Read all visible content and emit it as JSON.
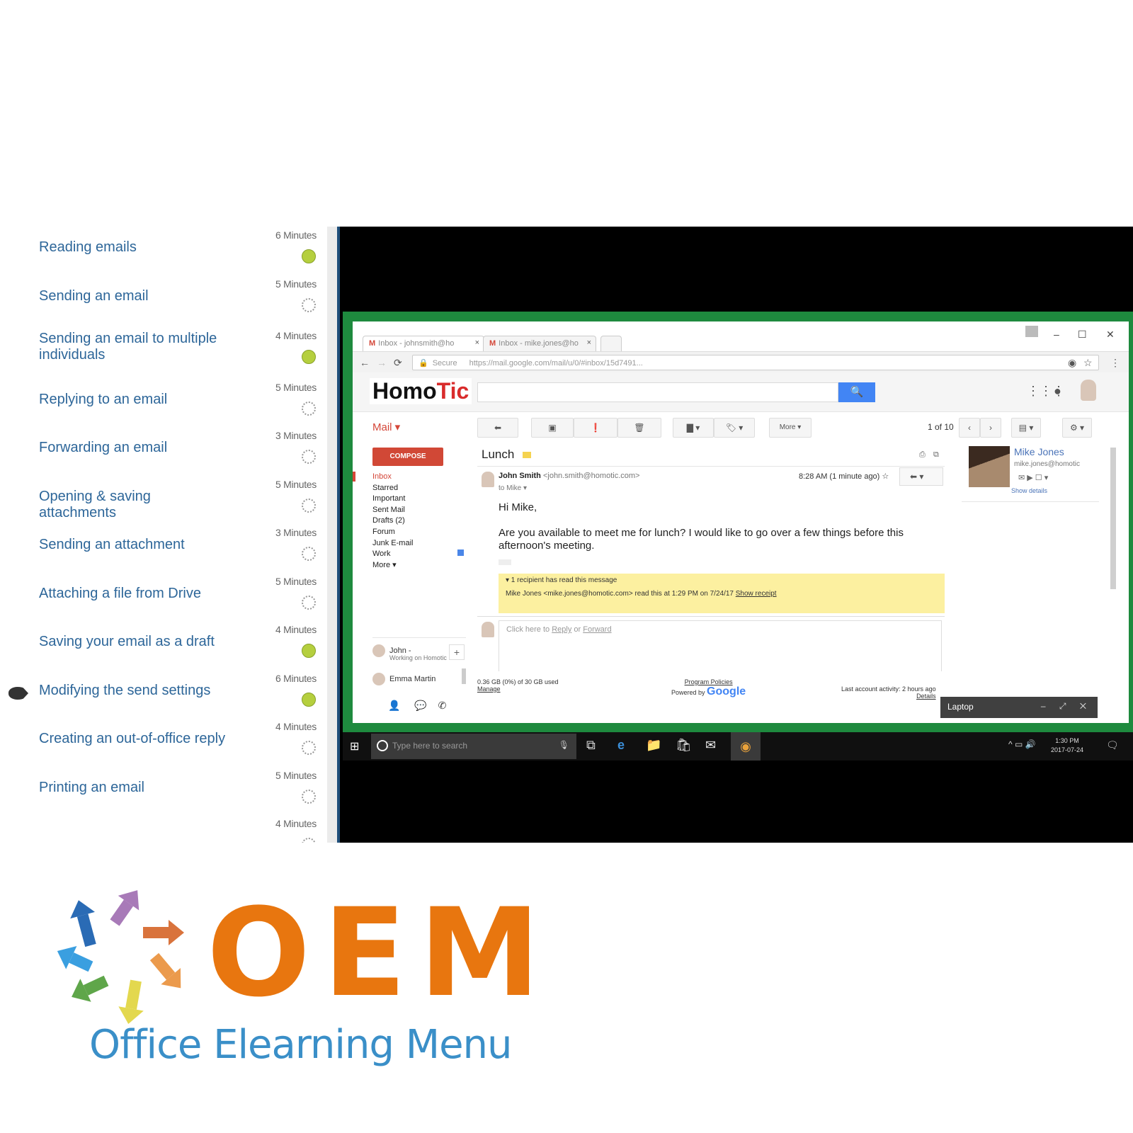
{
  "lessons": [
    {
      "title": "Reading emails",
      "duration": "6 Minutes",
      "status": "completed"
    },
    {
      "title": "Sending an email",
      "duration": "5 Minutes",
      "status": "not-started"
    },
    {
      "title": "Sending an email to multiple individuals",
      "duration": "4 Minutes",
      "status": "completed"
    },
    {
      "title": "Replying to an email",
      "duration": "5 Minutes",
      "status": "not-started"
    },
    {
      "title": "Forwarding an email",
      "duration": "3 Minutes",
      "status": "not-started"
    },
    {
      "title": "Opening & saving attachments",
      "duration": "5 Minutes",
      "status": "not-started"
    },
    {
      "title": "Sending an attachment",
      "duration": "3 Minutes",
      "status": "not-started"
    },
    {
      "title": "Attaching a file from Drive",
      "duration": "5 Minutes",
      "status": "not-started"
    },
    {
      "title": "Saving your email as a draft",
      "duration": "4 Minutes",
      "status": "completed"
    },
    {
      "title": "Modifying the send settings",
      "duration": "6 Minutes",
      "status": "completed",
      "current": true
    },
    {
      "title": "Creating an out-of-office reply",
      "duration": "4 Minutes",
      "status": "not-started"
    },
    {
      "title": "Printing an email",
      "duration": "5 Minutes",
      "status": "not-started"
    },
    {
      "title": "",
      "duration": "4 Minutes",
      "status": "not-started"
    }
  ],
  "browser": {
    "tabs": [
      {
        "label": "Inbox - johnsmith@ho",
        "close": "×"
      },
      {
        "label": "Inbox - mike.jones@ho",
        "close": "×"
      }
    ],
    "window_controls": {
      "minimize": "–",
      "maximize": "☐",
      "close": "✕"
    },
    "secure_label": "Secure",
    "url": "https://mail.google.com/mail/u/0/#inbox/15d7491...",
    "nav": {
      "back": "←",
      "forward": "→",
      "reload": "⟳"
    }
  },
  "gmail": {
    "logo_part1": "Homo",
    "logo_part2": "Tic",
    "search_icon": "🔍",
    "mail_label": "Mail ▾",
    "toolbar": {
      "back": "⬅",
      "archive": "▣",
      "spam": "❗",
      "delete": "🗑",
      "move": "▇ ▾",
      "labels": "🏷 ▾",
      "more": "More ▾",
      "pager": "1 of 10",
      "prev": "‹",
      "next": "›",
      "layout": "▤ ▾",
      "settings": "⚙ ▾"
    },
    "compose": "COMPOSE",
    "folders": [
      "Inbox",
      "Starred",
      "Important",
      "Sent Mail",
      "Drafts (2)",
      "Forum",
      "Junk E-mail",
      "Work",
      "More ▾"
    ],
    "chat": [
      {
        "name": "John -",
        "status": "Working on Homotic"
      },
      {
        "name": "Emma Martin",
        "status": ""
      }
    ],
    "chat_add": "+",
    "message": {
      "subject": "Lunch",
      "sender_name": "John Smith",
      "sender_email": "<john.smith@homotic.com>",
      "to": "to Mike ▾",
      "time": "8:28 AM (1 minute ago) ☆",
      "reply_icon": "⬅  ▾",
      "greeting": "Hi Mike,",
      "body": "Are you available to meet me for lunch? I would like to go over a few things before this afternoon's meeting.",
      "receipt_header": "▾ 1 recipient has read this message",
      "receipt_detail": "Mike Jones <mike.jones@homotic.com> read this at 1:29 PM on 7/24/17",
      "receipt_link": "Show receipt",
      "reply_prompt_prefix": "Click here to ",
      "reply_link": "Reply",
      "reply_or": " or ",
      "forward_link": "Forward"
    },
    "footer": {
      "storage": "0.36 GB (0%) of 30 GB used",
      "manage": "Manage",
      "policies": "Program Policies",
      "powered": "Powered by",
      "google": "Google",
      "activity": "Last account activity: 2 hours ago",
      "details": "Details"
    },
    "contact": {
      "name": "Mike Jones",
      "email": "mike.jones@homotic",
      "icons": "✉ ▶ ☐ ▾",
      "details": "Show details"
    },
    "chat_popup": {
      "title": "Laptop",
      "controls": "– ⤢ ✕"
    }
  },
  "taskbar": {
    "start": "⊞",
    "search_placeholder": "Type here to search",
    "mic": "🎙",
    "apps": [
      "⧉",
      "e",
      "📁",
      "🛍",
      "✉",
      "◉"
    ],
    "tray": "^ ▭ 🔊",
    "time": "1:30 PM",
    "date": "2017-07-24",
    "notifications": "🗨"
  },
  "brand": {
    "letters": "OEM",
    "tagline": "Office Elearning Menu",
    "colors": {
      "orange": "#e8760f",
      "blue": "#3a8fc8"
    }
  }
}
